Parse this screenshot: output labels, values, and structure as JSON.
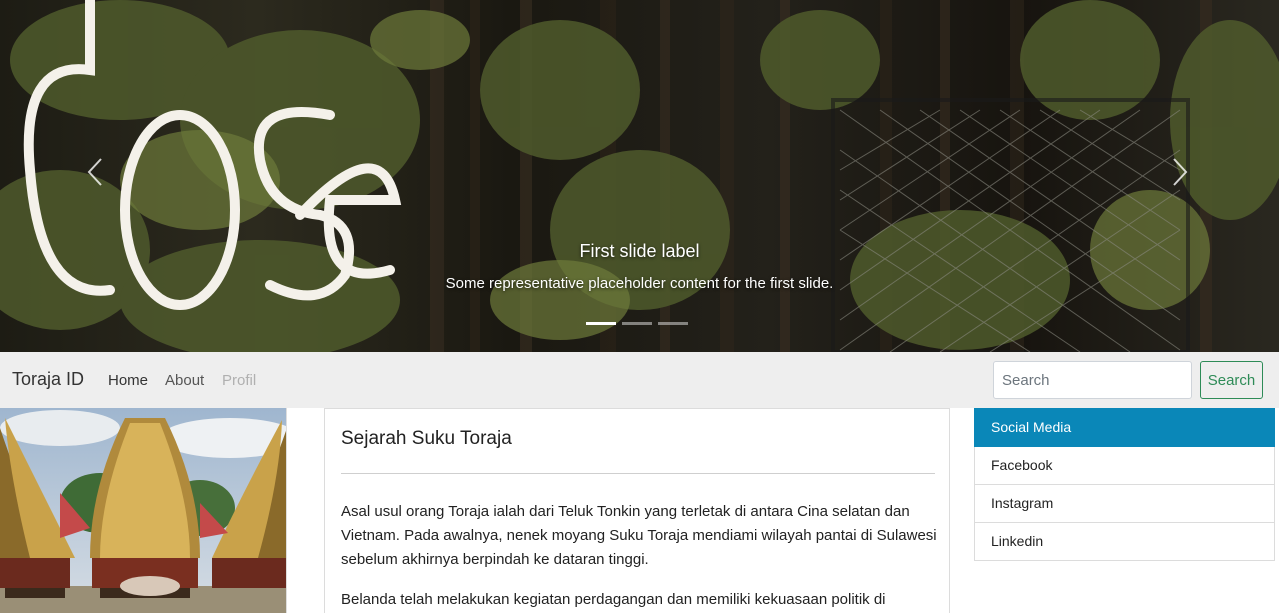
{
  "carousel": {
    "caption_title": "First slide label",
    "caption_text": "Some representative placeholder content for the first slide.",
    "indicator_count": 3,
    "active_index": 0,
    "sign_text": "cose"
  },
  "navbar": {
    "brand": "Toraja ID",
    "links": [
      "Home",
      "About",
      "Profil"
    ],
    "search_placeholder": "Search",
    "search_button": "Search"
  },
  "article": {
    "title": "Sejarah Suku Toraja",
    "paragraphs": [
      "Asal usul orang Toraja ialah dari Teluk Tonkin yang terletak di antara Cina selatan dan Vietnam. Pada awalnya, nenek moyang Suku Toraja mendiami wilayah pantai di Sulawesi sebelum akhirnya berpindah ke dataran tinggi.",
      "Belanda telah melakukan kegiatan perdagangan dan memiliki kekuasaan politik di"
    ]
  },
  "social": {
    "header": "Social Media",
    "items": [
      "Facebook",
      "Instagram",
      "Linkedin"
    ]
  },
  "colors": {
    "accent": "#0a87b8",
    "search_button": "#2e8b57",
    "navbar_bg": "#eeeeee"
  }
}
